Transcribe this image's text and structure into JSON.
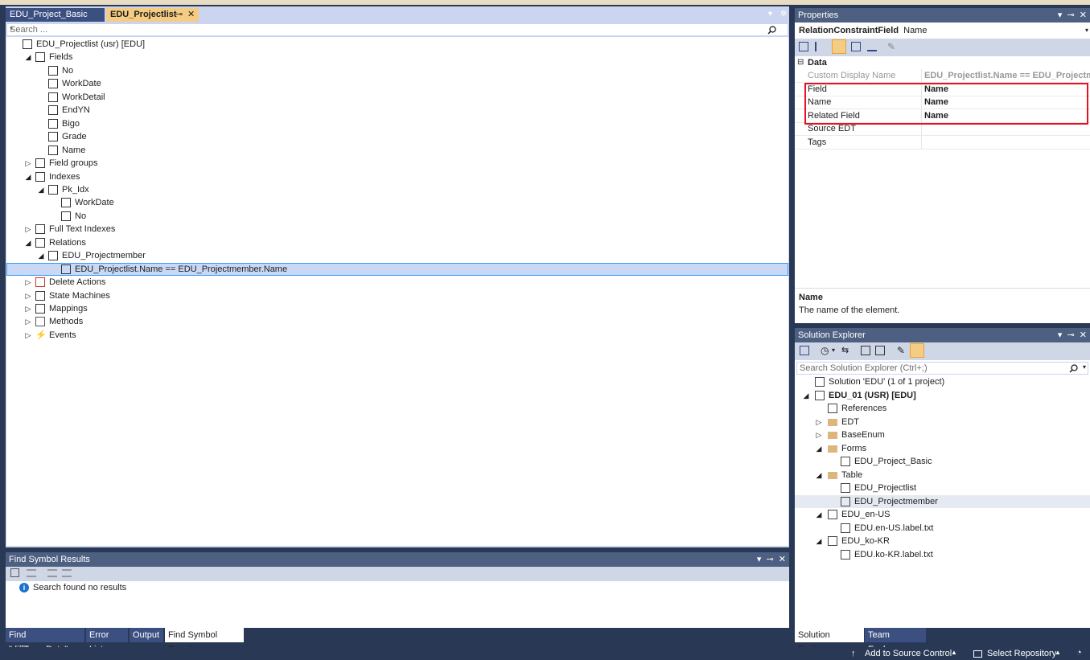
{
  "doc_tabs": {
    "inactive": "EDU_Project_Basic",
    "active": "EDU_Projectlist",
    "pin_glyph": "⊸",
    "close_glyph": "✕"
  },
  "editor": {
    "search_placeholder": "Search ...",
    "tree": [
      {
        "label": "EDU_Projectlist (usr) [EDU]",
        "level": 0,
        "expander": "",
        "icon": "table-icon"
      },
      {
        "label": "Fields",
        "level": 1,
        "expander": "◢",
        "icon": "fields-icon"
      },
      {
        "label": "No",
        "level": 2,
        "expander": "",
        "icon": "field-icon"
      },
      {
        "label": "WorkDate",
        "level": 2,
        "expander": "",
        "icon": "field-icon"
      },
      {
        "label": "WorkDetail",
        "level": 2,
        "expander": "",
        "icon": "field-icon"
      },
      {
        "label": "EndYN",
        "level": 2,
        "expander": "",
        "icon": "field-icon"
      },
      {
        "label": "Bigo",
        "level": 2,
        "expander": "",
        "icon": "field-icon"
      },
      {
        "label": "Grade",
        "level": 2,
        "expander": "",
        "icon": "field-icon"
      },
      {
        "label": "Name",
        "level": 2,
        "expander": "",
        "icon": "field-icon"
      },
      {
        "label": "Field groups",
        "level": 1,
        "expander": "▷",
        "icon": "field-groups-icon"
      },
      {
        "label": "Indexes",
        "level": 1,
        "expander": "◢",
        "icon": "index-icon"
      },
      {
        "label": "Pk_Idx",
        "level": 2,
        "expander": "◢",
        "icon": "index-icon"
      },
      {
        "label": "WorkDate",
        "level": 3,
        "expander": "",
        "icon": "field-icon"
      },
      {
        "label": "No",
        "level": 3,
        "expander": "",
        "icon": "field-icon"
      },
      {
        "label": "Full Text Indexes",
        "level": 1,
        "expander": "▷",
        "icon": "fulltext-icon"
      },
      {
        "label": "Relations",
        "level": 1,
        "expander": "◢",
        "icon": "relation-icon"
      },
      {
        "label": "EDU_Projectmember",
        "level": 2,
        "expander": "◢",
        "icon": "relation-icon"
      },
      {
        "label": "EDU_Projectlist.Name == EDU_Projectmember.Name",
        "level": 3,
        "expander": "",
        "icon": "relation-field-icon",
        "selected": true
      },
      {
        "label": "Delete Actions",
        "level": 1,
        "expander": "▷",
        "icon": "delete-actions-icon"
      },
      {
        "label": "State Machines",
        "level": 1,
        "expander": "▷",
        "icon": "state-machine-icon"
      },
      {
        "label": "Mappings",
        "level": 1,
        "expander": "▷",
        "icon": "mappings-icon"
      },
      {
        "label": "Methods",
        "level": 1,
        "expander": "▷",
        "icon": "methods-icon"
      },
      {
        "label": "Events",
        "level": 1,
        "expander": "▷",
        "icon": "events-icon"
      }
    ]
  },
  "find_panel": {
    "title": "Find Symbol Results",
    "message": "Search found no results"
  },
  "bottom_tabs": [
    "Find \"diffTransDate\"",
    "Error List",
    "Output",
    "Find Symbol Results"
  ],
  "properties": {
    "title": "Properties",
    "object_type": "RelationConstraintField",
    "object_name": "Name",
    "category": "Data",
    "rows": [
      {
        "name": "Custom Display Name",
        "value": "EDU_Projectlist.Name == EDU_Projectmember.Name",
        "muted": true
      },
      {
        "name": "Field",
        "value": "Name"
      },
      {
        "name": "Name",
        "value": "Name"
      },
      {
        "name": "Related Field",
        "value": "Name"
      },
      {
        "name": "Source EDT",
        "value": ""
      },
      {
        "name": "Tags",
        "value": ""
      }
    ],
    "desc_title": "Name",
    "desc_text": "The name of the element."
  },
  "solution_explorer": {
    "title": "Solution Explorer",
    "search_placeholder": "Search Solution Explorer (Ctrl+;)",
    "items": [
      {
        "label": "Solution 'EDU' (1 of 1 project)",
        "level": 0,
        "expander": "",
        "icon": "solution-icon",
        "bold": false
      },
      {
        "label": "EDU_01 (USR) [EDU]",
        "level": 0,
        "expander": "◢",
        "icon": "project-icon",
        "bold": true
      },
      {
        "label": "References",
        "level": 1,
        "expander": "",
        "icon": "references-icon",
        "bold": false
      },
      {
        "label": "EDT",
        "level": 1,
        "expander": "▷",
        "icon": "folder-icon",
        "bold": false
      },
      {
        "label": "BaseEnum",
        "level": 1,
        "expander": "▷",
        "icon": "folder-icon",
        "bold": false
      },
      {
        "label": "Forms",
        "level": 1,
        "expander": "◢",
        "icon": "folder-open-icon",
        "bold": false
      },
      {
        "label": "EDU_Project_Basic",
        "level": 2,
        "expander": "",
        "icon": "form-icon",
        "bold": false
      },
      {
        "label": "Table",
        "level": 1,
        "expander": "◢",
        "icon": "folder-open-icon",
        "bold": false
      },
      {
        "label": "EDU_Projectlist",
        "level": 2,
        "expander": "",
        "icon": "table-icon",
        "bold": false
      },
      {
        "label": "EDU_Projectmember",
        "level": 2,
        "expander": "",
        "icon": "table-icon",
        "bold": false,
        "selected": true
      },
      {
        "label": "EDU_en-US",
        "level": 1,
        "expander": "◢",
        "icon": "label-file-icon",
        "bold": false
      },
      {
        "label": "EDU.en-US.label.txt",
        "level": 2,
        "expander": "",
        "icon": "text-file-icon",
        "bold": false
      },
      {
        "label": "EDU_ko-KR",
        "level": 1,
        "expander": "◢",
        "icon": "label-file-icon",
        "bold": false
      },
      {
        "label": "EDU.ko-KR.label.txt",
        "level": 2,
        "expander": "",
        "icon": "text-file-icon",
        "bold": false
      }
    ],
    "tabs": [
      "Solution Explorer",
      "Team Explorer"
    ]
  },
  "status": {
    "add_source_control": "Add to Source Control",
    "select_repo": "Select Repository"
  },
  "colors": {
    "highlight_box": "#e81123",
    "accent_tab": "#f5cc84",
    "chrome": "#293955"
  }
}
